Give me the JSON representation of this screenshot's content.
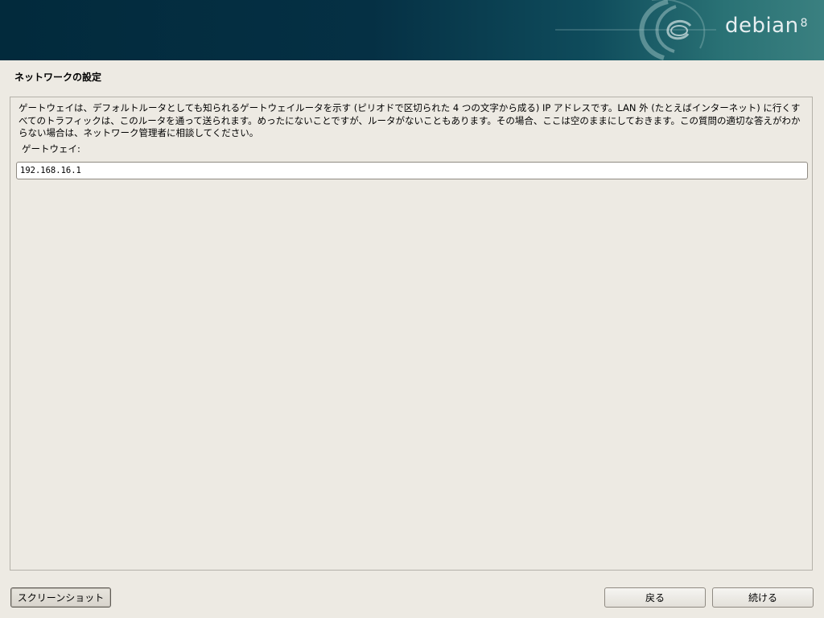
{
  "banner": {
    "logo_text": "debian",
    "logo_version": "8"
  },
  "page": {
    "title": "ネットワークの設定"
  },
  "form": {
    "description": "ゲートウェイは、デフォルトルータとしても知られるゲートウェイルータを示す (ピリオドで区切られた 4 つの文字から成る) IP アドレスです。LAN 外 (たとえばインターネット) に行くすべてのトラフィックは、このルータを通って送られます。めったにないことですが、ルータがないこともあります。その場合、ここは空のままにしておきます。この質問の適切な答えがわからない場合は、ネットワーク管理者に相談してください。",
    "gateway_label": "ゲートウェイ:",
    "gateway_value": "192.168.16.1"
  },
  "buttons": {
    "screenshot": "スクリーンショット",
    "back": "戻る",
    "continue": "続ける"
  },
  "colors": {
    "banner_dark": "#022a3c",
    "banner_light": "#3a8080",
    "background": "#edeae3"
  },
  "icons": {
    "banner_swirl": "debian-swirl-icon"
  }
}
